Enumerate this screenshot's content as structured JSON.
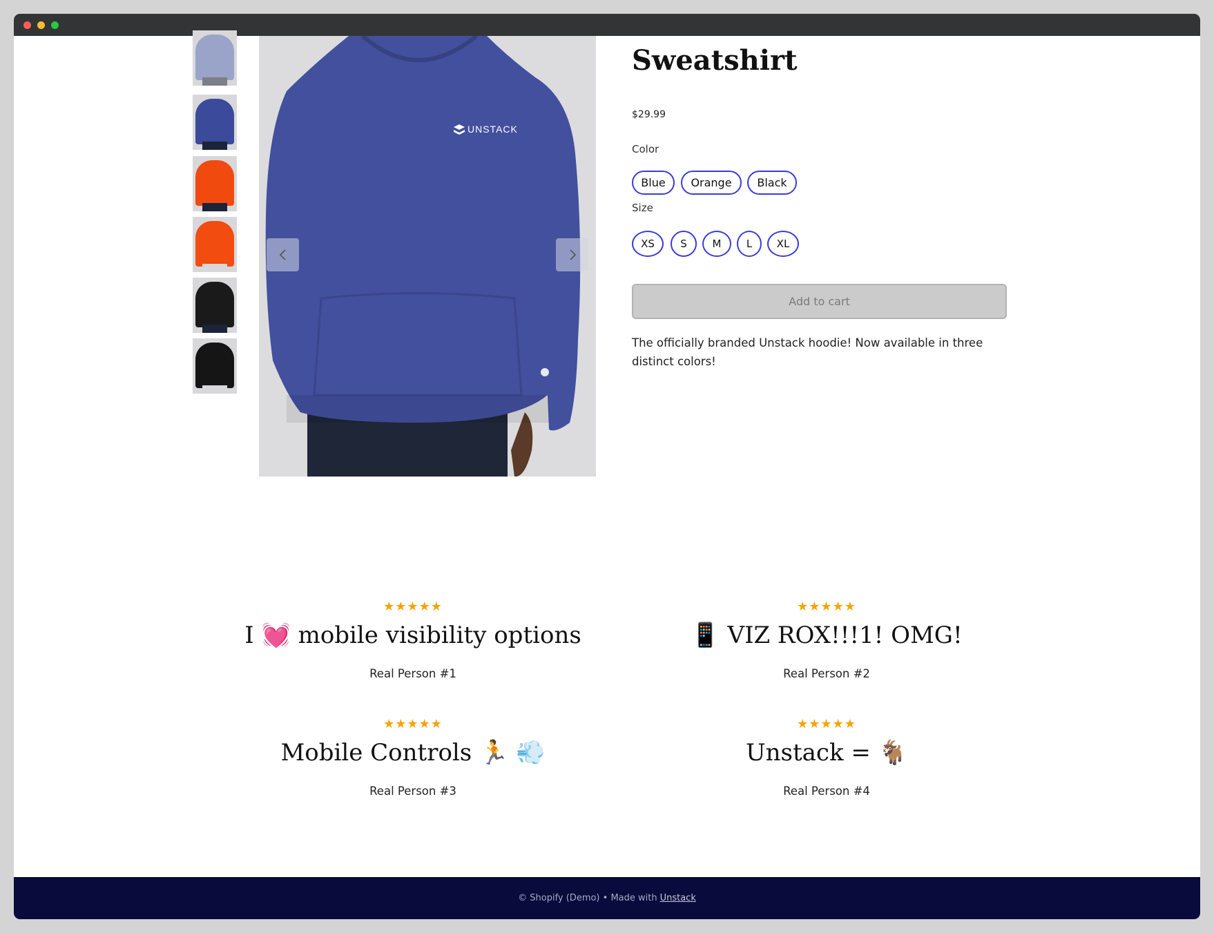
{
  "product": {
    "title": "Sweatshirt",
    "price": "$29.99",
    "color_label": "Color",
    "colors": [
      "Blue",
      "Orange",
      "Black"
    ],
    "size_label": "Size",
    "sizes": [
      "XS",
      "S",
      "M",
      "L",
      "XL"
    ],
    "add_to_cart": "Add to cart",
    "description": "The officially branded Unstack hoodie! Now available in three distinct colors!",
    "image_logo_text": "UNSTACK",
    "thumbnails": [
      {
        "color": "#9aa3c8"
      },
      {
        "color": "#3b4a9a"
      },
      {
        "color": "#f14a0f"
      },
      {
        "color": "#f24c10"
      },
      {
        "color": "#1a1a1a"
      },
      {
        "color": "#151515"
      }
    ],
    "main_color": "#42509e"
  },
  "reviews": [
    {
      "stars": "★★★★★",
      "title": "I 💓 mobile visibility options",
      "author": "Real Person #1"
    },
    {
      "stars": "★★★★★",
      "title": "📱 VIZ ROX!!!1! OMG!",
      "author": "Real Person #2"
    },
    {
      "stars": "★★★★★",
      "title": "Mobile Controls 🏃 💨",
      "author": "Real Person #3"
    },
    {
      "stars": "★★★★★",
      "title": "Unstack = 🐐",
      "author": "Real Person #4"
    }
  ],
  "footer": {
    "text": "© Shopify (Demo) • Made with",
    "link": "Unstack"
  },
  "icons": {
    "prev": "chevron-left-icon",
    "next": "chevron-right-icon",
    "star": "star-icon"
  }
}
